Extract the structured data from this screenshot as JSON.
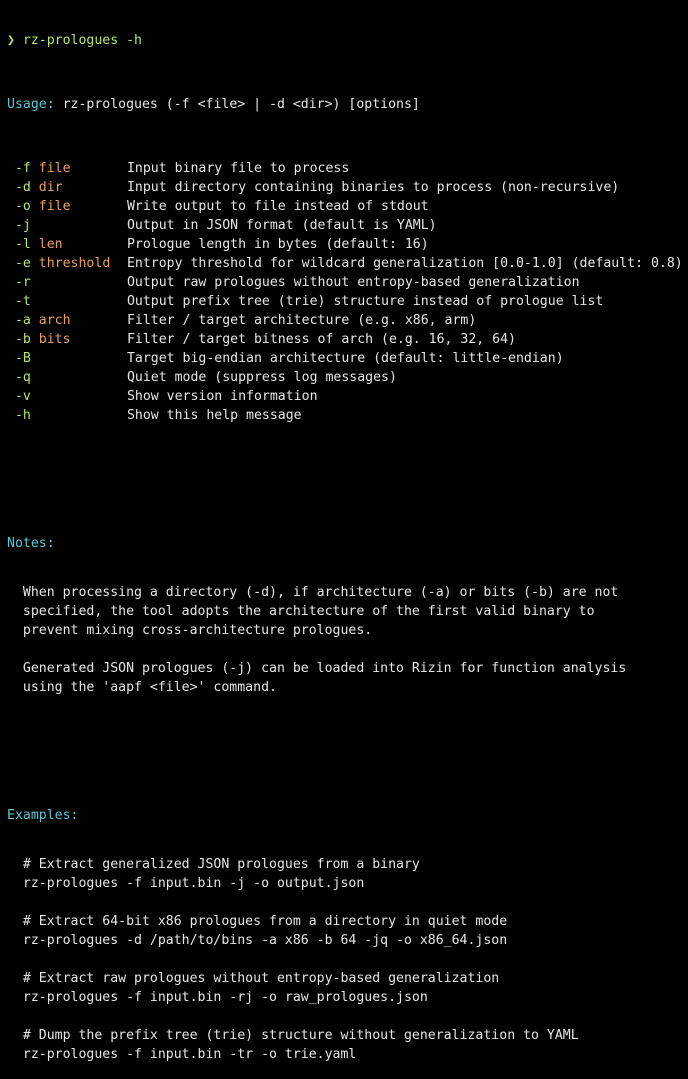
{
  "prompt": {
    "symbol": "❯",
    "command": "rz-prologues -h"
  },
  "usage": {
    "label": "Usage:",
    "text": "rz-prologues (-f <file> | -d <dir>) [options]"
  },
  "options": [
    {
      "flag": "-f",
      "arg": "file",
      "desc": "Input binary file to process"
    },
    {
      "flag": "-d",
      "arg": "dir",
      "desc": "Input directory containing binaries to process (non-recursive)"
    },
    {
      "flag": "-o",
      "arg": "file",
      "desc": "Write output to file instead of stdout"
    },
    {
      "flag": "-j",
      "arg": "",
      "desc": "Output in JSON format (default is YAML)"
    },
    {
      "flag": "-l",
      "arg": "len",
      "desc": "Prologue length in bytes (default: 16)"
    },
    {
      "flag": "-e",
      "arg": "threshold",
      "desc": "Entropy threshold for wildcard generalization [0.0-1.0] (default: 0.8)"
    },
    {
      "flag": "-r",
      "arg": "",
      "desc": "Output raw prologues without entropy-based generalization"
    },
    {
      "flag": "-t",
      "arg": "",
      "desc": "Output prefix tree (trie) structure instead of prologue list"
    },
    {
      "flag": "-a",
      "arg": "arch",
      "desc": "Filter / target architecture (e.g. x86, arm)"
    },
    {
      "flag": "-b",
      "arg": "bits",
      "desc": "Filter / target bitness of arch (e.g. 16, 32, 64)"
    },
    {
      "flag": "-B",
      "arg": "",
      "desc": "Target big-endian architecture (default: little-endian)"
    },
    {
      "flag": "-q",
      "arg": "",
      "desc": "Quiet mode (suppress log messages)"
    },
    {
      "flag": "-v",
      "arg": "",
      "desc": "Show version information"
    },
    {
      "flag": "-h",
      "arg": "",
      "desc": "Show this help message"
    }
  ],
  "notes": {
    "label": "Notes:",
    "lines": [
      "  When processing a directory (-d), if architecture (-a) or bits (-b) are not",
      "  specified, the tool adopts the architecture of the first valid binary to",
      "  prevent mixing cross-architecture prologues.",
      "",
      "  Generated JSON prologues (-j) can be loaded into Rizin for function analysis",
      "  using the 'aapf <file>' command."
    ]
  },
  "examples": {
    "label": "Examples:",
    "lines": [
      "  # Extract generalized JSON prologues from a binary",
      "  rz-prologues -f input.bin -j -o output.json",
      "",
      "  # Extract 64-bit x86 prologues from a directory in quiet mode",
      "  rz-prologues -d /path/to/bins -a x86 -b 64 -jq -o x86_64.json",
      "",
      "  # Extract raw prologues without entropy-based generalization",
      "  rz-prologues -f input.bin -rj -o raw_prologues.json",
      "",
      "  # Dump the prefix tree (trie) structure without generalization to YAML",
      "  rz-prologues -f input.bin -tr -o trie.yaml"
    ]
  },
  "colors": {
    "background": "#000000",
    "text": "#e6e6e6",
    "prompt": "#b6e36c",
    "heading": "#58c6d8",
    "argument": "#e6a05a"
  }
}
